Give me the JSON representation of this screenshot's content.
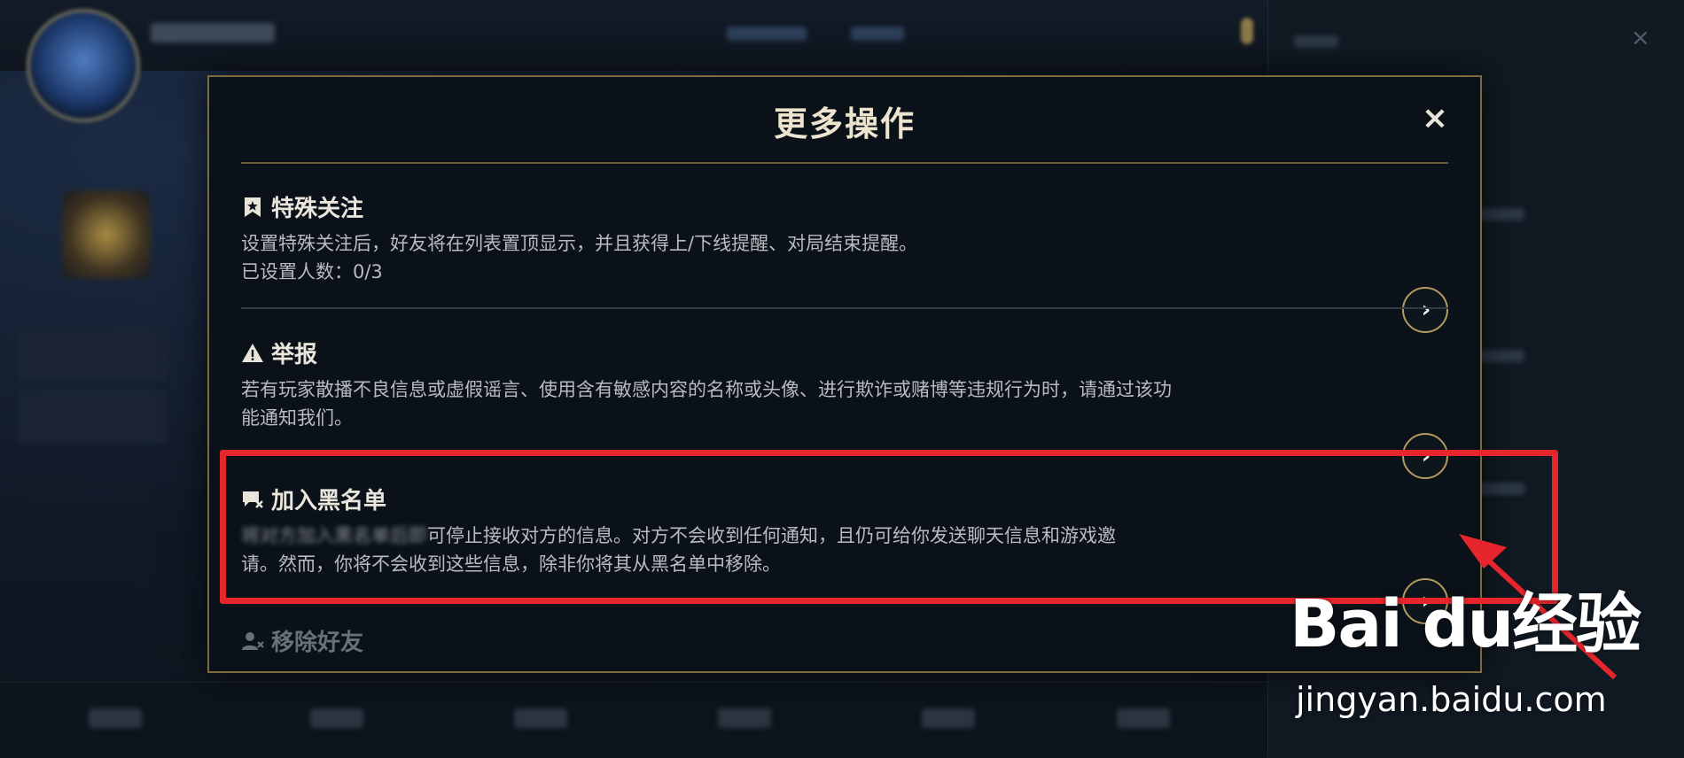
{
  "modal": {
    "title": "更多操作",
    "close_label": "×",
    "options": [
      {
        "title": "特殊关注",
        "icon": "star-bookmark-icon",
        "desc_line1": "设置特殊关注后，好友将在列表置顶显示，并且获得上/下线提醒、对局结束提醒。",
        "desc_line2": "已设置人数：0/3",
        "arrow": "›"
      },
      {
        "title": "举报",
        "icon": "warning-icon",
        "desc_line1": "若有玩家散播不良信息或虚假谣言、使用含有敏感内容的名称或头像、进行欺诈或赌博等违规行为时，请通过该功",
        "desc_line2": "能通知我们。",
        "arrow": "›"
      },
      {
        "title": "加入黑名单",
        "icon": "block-chat-icon",
        "desc_blurred": "将对方加入黑名单后即",
        "desc_line1_rest": "可停止接收对方的信息。对方不会收到任何通知，且仍可给你发送聊天信息和游戏邀",
        "desc_line2": "请。然而，你将不会收到这些信息，除非你将其从黑名单中移除。",
        "arrow": "›"
      },
      {
        "title": "移除好友",
        "icon": "remove-friend-icon"
      }
    ]
  },
  "watermark": {
    "brand": "Bai du经验",
    "url": "jingyan.baidu.com"
  },
  "colors": {
    "accent_gold": "#b39a5e",
    "highlight_red": "#e6262c",
    "modal_bg": "#0a1118"
  }
}
